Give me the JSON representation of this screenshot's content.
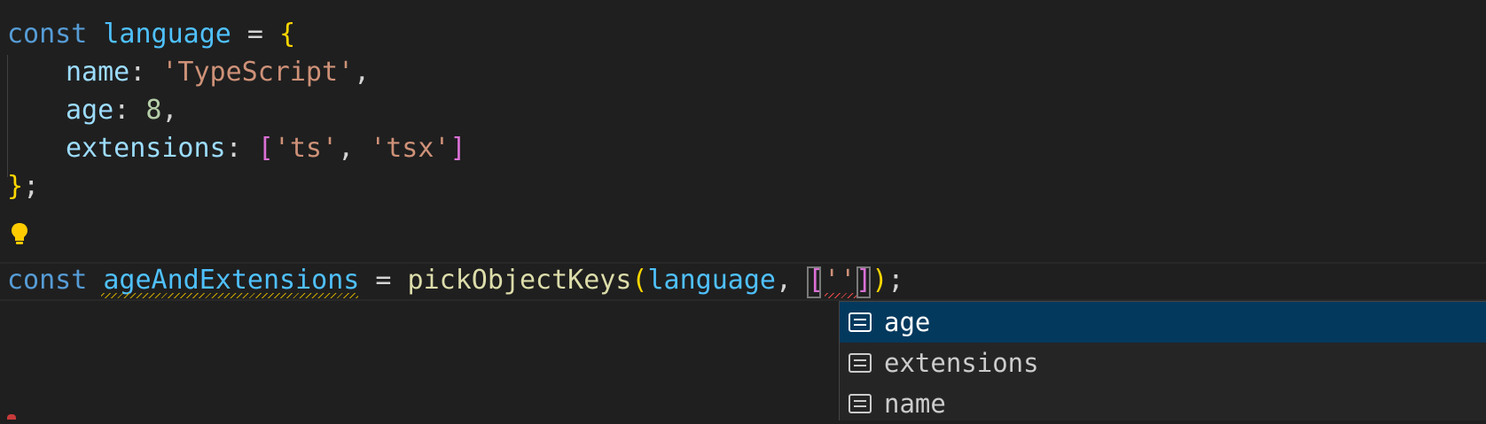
{
  "code": {
    "line1": {
      "kw": "const",
      "name": "language",
      "op": " = ",
      "brace": "{"
    },
    "line2": {
      "prop": "name",
      "colon": ": ",
      "value": "'TypeScript'",
      "comma": ","
    },
    "line3": {
      "prop": "age",
      "colon": ": ",
      "value": "8",
      "comma": ","
    },
    "line4": {
      "prop": "extensions",
      "colon": ": ",
      "open": "[",
      "v1": "'ts'",
      "sep": ", ",
      "v2": "'tsx'",
      "close": "]"
    },
    "line5": {
      "brace": "}",
      "semi": ";"
    },
    "line7": {
      "kw": "const",
      "name": "ageAndExtensions",
      "op": " = ",
      "fn": "pickObjectKeys",
      "paren_open": "(",
      "arg1": "language",
      "sep": ", ",
      "bracket_open": "[",
      "str": "''",
      "bracket_close": "]",
      "paren_close": ")",
      "semi": ";"
    }
  },
  "suggestions": [
    {
      "label": "age",
      "icon": "property-icon",
      "selected": true
    },
    {
      "label": "extensions",
      "icon": "property-icon",
      "selected": false
    },
    {
      "label": "name",
      "icon": "property-icon",
      "selected": false
    }
  ],
  "colors": {
    "background": "#1f1f1f",
    "keyword": "#569cd6",
    "variable": "#4fc1ff",
    "property": "#9cdcfe",
    "string": "#ce9178",
    "number": "#b5cea8",
    "function": "#dcdcaa",
    "selection": "#04395e",
    "warning": "#cca700",
    "error": "#f14c4c",
    "lightbulb": "#ffcc00"
  }
}
